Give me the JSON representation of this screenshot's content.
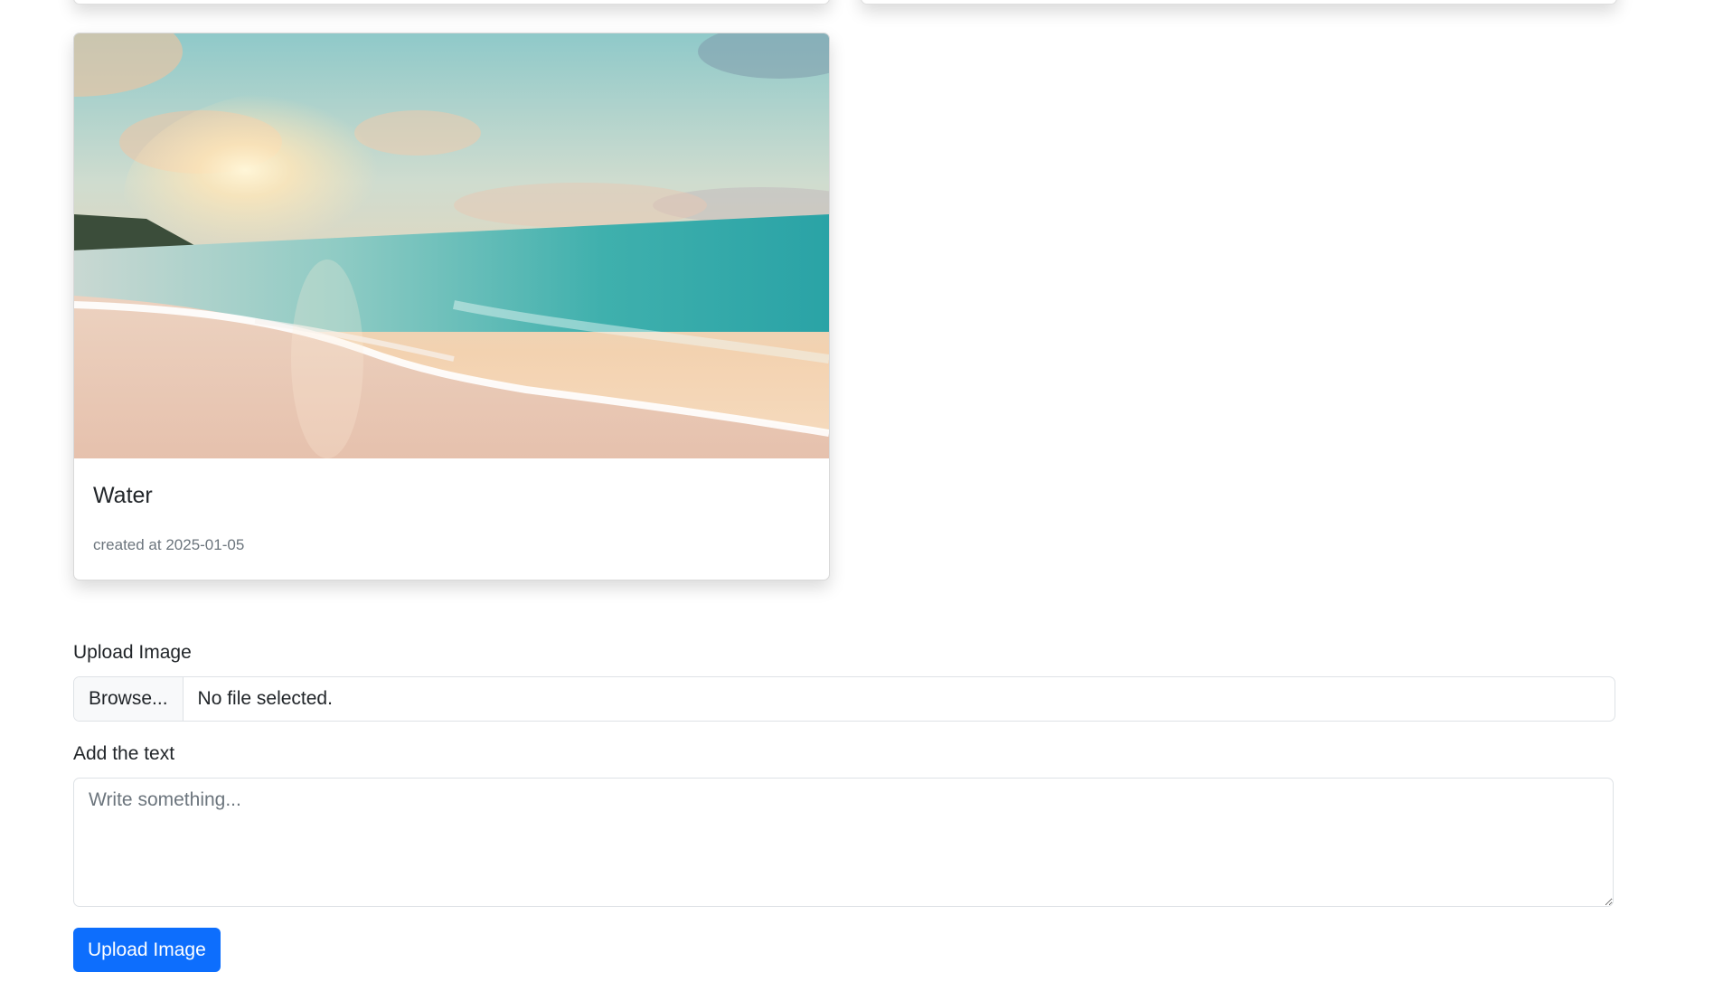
{
  "posts": [
    {
      "title": "Water",
      "created_text": "created at 2025-01-05",
      "image": {
        "alt": "beach-sunset-photo"
      }
    }
  ],
  "form": {
    "upload_label": "Upload Image",
    "browse_label": "Browse...",
    "file_status": "No file selected.",
    "text_label": "Add the text",
    "text_placeholder": "Write something...",
    "submit_label": "Upload Image"
  },
  "colors": {
    "primary": "#0d6efd",
    "muted": "#6c757d",
    "border": "#dee2e6"
  }
}
